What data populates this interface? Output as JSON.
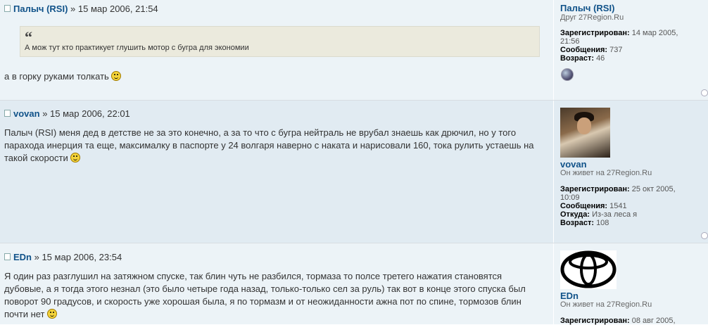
{
  "posts": [
    {
      "author": "Палыч (RSI)",
      "date": " » 15 мар 2006, 21:54",
      "quote_mark": "“",
      "quote": "А мож тут кто практикует глушить мотор с бугра для экономии",
      "text": "а в горку руками толкать",
      "profile": {
        "username": "Палыч (RSI)",
        "rank": "Друг 27Region.Ru",
        "registered_label": "Зарегистрирован:",
        "registered_value": "14 мар 2005,",
        "registered_value2": "21:56",
        "messages_label": "Сообщения:",
        "messages_value": "737",
        "age_label": "Возраст:",
        "age_value": "46"
      }
    },
    {
      "author": "vovan",
      "date": " » 15 мар 2006, 22:01",
      "text_lines": [
        "Палыч (RSI) меня дед в детстве не за это конечно, а за то что с бугра нейтраль не врубал знаешь как дрючил, но у того",
        "парахода инерция та еще, максималку в паспорте у 24 волгаря наверно с наката и нарисовали 160, тока рулить устаешь на",
        "такой скорости"
      ],
      "profile": {
        "username": "vovan",
        "rank": "Он живет на 27Region.Ru",
        "registered_label": "Зарегистрирован:",
        "registered_value": "25 окт 2005,",
        "registered_value2": "10:09",
        "messages_label": "Сообщения:",
        "messages_value": "1541",
        "from_label": "Откуда:",
        "from_value": "Из-за леса я",
        "age_label": "Возраст:",
        "age_value": "108"
      }
    },
    {
      "author": "EDn",
      "date": " » 15 мар 2006, 23:54",
      "text_lines": [
        "Я один раз разглушил на затяжном спуске, так блин чуть не разбился, тормаза то полсе третего нажатия становятся",
        "дубовые, а я тогда этого незнал (это было четыре года назад, только-только сел за руль) так вот в конце этого спуска был",
        "поворот 90 градусов, и скорость уже хорошая была, я по тормазм и от неожиданности ажна пот по спине, тормозов блин",
        "почти нет"
      ],
      "profile": {
        "username": "EDn",
        "rank": "Он живет на 27Region.Ru",
        "registered_label": "Зарегистрирован:",
        "registered_value": "08 авг 2005,"
      }
    }
  ]
}
